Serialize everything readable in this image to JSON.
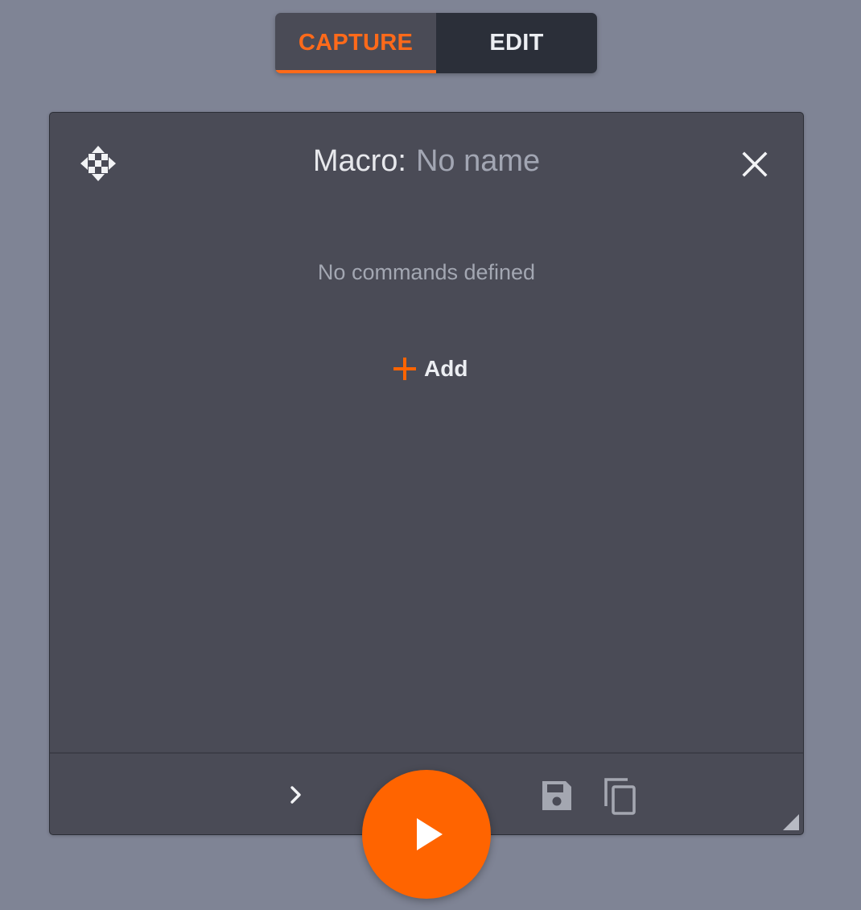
{
  "colors": {
    "accent": "#ff6400",
    "background": "#7f8495",
    "panel": "#4a4b56",
    "tab_inactive": "#2b2f39"
  },
  "mode_tabs": {
    "capture_label": "CAPTURE",
    "edit_label": "EDIT",
    "active": "capture"
  },
  "macro": {
    "title_label": "Macro:",
    "name_placeholder": "No name",
    "empty_message": "No commands defined",
    "add_label": "Add"
  },
  "icons": {
    "move": "move-arrows-icon",
    "close": "close-icon",
    "add": "plus-icon",
    "expand": "chevron-right-icon",
    "save": "save-icon",
    "copy": "copy-icon",
    "play": "play-icon",
    "resize": "resize-corner-icon"
  }
}
